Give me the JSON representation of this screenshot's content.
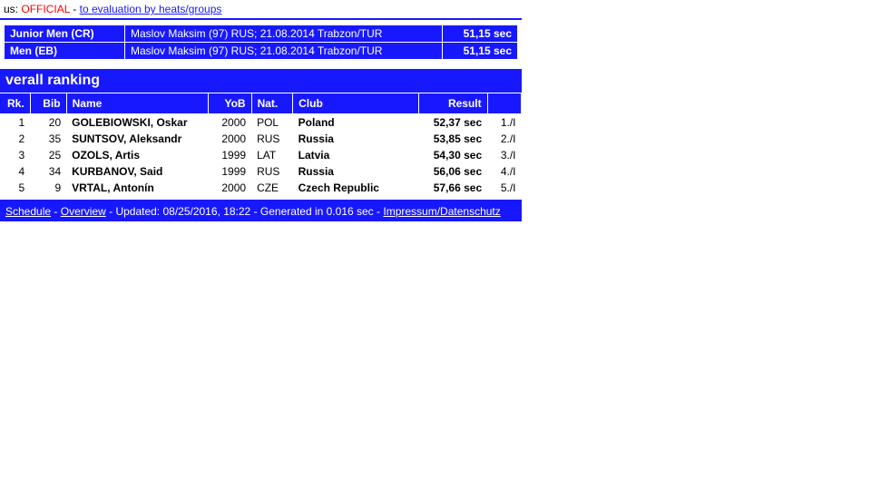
{
  "status": {
    "prefix": "us:",
    "official": "OFFICIAL",
    "dash": "-",
    "link": "to evaluation by heats/groups"
  },
  "records": [
    {
      "category": "Junior Men (CR)",
      "detail": "Maslov Maksim (97) RUS; 21.08.2014 Trabzon/TUR",
      "time": "51,15 sec"
    },
    {
      "category": "Men (EB)",
      "detail": "Maslov Maksim (97) RUS; 21.08.2014 Trabzon/TUR",
      "time": "51,15 sec"
    }
  ],
  "section_title": "verall ranking",
  "columns": {
    "rk": "Rk.",
    "bib": "Bib",
    "name": "Name",
    "yob": "YoB",
    "nat": "Nat.",
    "club": "Club",
    "result": "Result",
    "heat": ""
  },
  "rows": [
    {
      "rk": "1",
      "bib": "20",
      "name": "GOLEBIOWSKI, Oskar",
      "yob": "2000",
      "nat": "POL",
      "club": "Poland",
      "result": "52,37 sec",
      "heat": "1./I"
    },
    {
      "rk": "2",
      "bib": "35",
      "name": "SUNTSOV, Aleksandr",
      "yob": "2000",
      "nat": "RUS",
      "club": "Russia",
      "result": "53,85 sec",
      "heat": "2./I"
    },
    {
      "rk": "3",
      "bib": "25",
      "name": "OZOLS, Artis",
      "yob": "1999",
      "nat": "LAT",
      "club": "Latvia",
      "result": "54,30 sec",
      "heat": "3./I"
    },
    {
      "rk": "4",
      "bib": "34",
      "name": "KURBANOV, Said",
      "yob": "1999",
      "nat": "RUS",
      "club": "Russia",
      "result": "56,06 sec",
      "heat": "4./I"
    },
    {
      "rk": "5",
      "bib": "9",
      "name": "VRTAL, Antonín",
      "yob": "2000",
      "nat": "CZE",
      "club": "Czech Republic",
      "result": "57,66 sec",
      "heat": "5./I"
    }
  ],
  "footer": {
    "schedule": "Schedule",
    "overview": "Overview",
    "updated": "Updated: 08/25/2016, 18:22",
    "generated": "Generated in 0.016 sec",
    "impressum": "Impressum/Datenschutz",
    "sep": " - "
  }
}
